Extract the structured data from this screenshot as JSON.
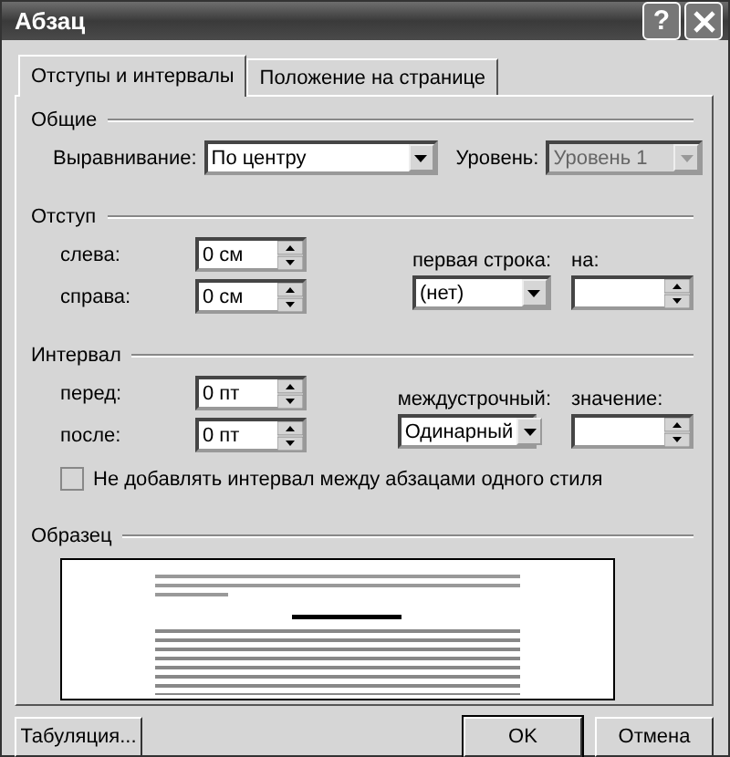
{
  "window": {
    "title": "Абзац",
    "help_button": "?"
  },
  "tabs": [
    {
      "label": "Отступы и интервалы",
      "selected": true
    },
    {
      "label": "Положение на странице",
      "selected": false
    }
  ],
  "general": {
    "heading": "Общие",
    "alignment": {
      "label": "Выравнивание:",
      "value": "По центру",
      "disabled": false
    },
    "level": {
      "label": "Уровень:",
      "value": "Уровень 1",
      "disabled": true
    }
  },
  "indent": {
    "heading": "Отступ",
    "left": {
      "label": "слева:",
      "value": "0 см"
    },
    "right": {
      "label": "справа:",
      "value": "0 см"
    },
    "first_line": {
      "label": "первая строка:",
      "value": "(нет)"
    },
    "by": {
      "label": "на:"
    }
  },
  "spacing": {
    "heading": "Интервал",
    "before": {
      "label": "перед:",
      "value": "0 пт"
    },
    "after": {
      "label": "после:",
      "value": "0 пт"
    },
    "line_spacing": {
      "label": "междустрочный:",
      "value": "Одинарный"
    },
    "at": {
      "label": "значение:"
    },
    "no_space_same_style": {
      "label": "Не добавлять интервал между абзацами одного стиля",
      "checked": false
    }
  },
  "preview": {
    "heading": "Образец"
  },
  "buttons": [
    {
      "kind": "tabs",
      "label": "Табуляция..."
    },
    {
      "kind": "ok",
      "label": "OK"
    },
    {
      "kind": "cancel",
      "label": "Отмена"
    }
  ]
}
